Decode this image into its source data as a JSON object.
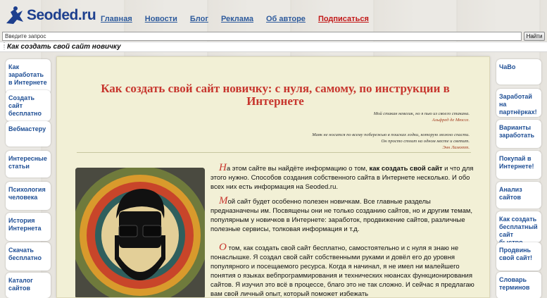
{
  "header": {
    "logo_text": "Seoded.ru",
    "nav": [
      {
        "label": "Главная"
      },
      {
        "label": "Новости"
      },
      {
        "label": "Блог"
      },
      {
        "label": "Реклама"
      },
      {
        "label": "Об авторе"
      },
      {
        "label": "Подписаться"
      }
    ]
  },
  "search": {
    "placeholder": "Введите запрос",
    "button_label": "Найти"
  },
  "breadcrumb": {
    "title": "Как создать свой сайт новичку"
  },
  "left_menu": [
    {
      "label": "Как заработать в Интернете"
    },
    {
      "label": "Создать сайт бесплатно"
    },
    {
      "label": "Вебмастеру"
    },
    {
      "label": "Интересные статьи"
    },
    {
      "label": "Психология человека"
    },
    {
      "label": "История Интернета"
    },
    {
      "label": "Скачать бесплатно"
    },
    {
      "label": "Каталог сайтов"
    }
  ],
  "right_menu": [
    {
      "label": "ЧаВо"
    },
    {
      "label": "Заработай на партнёрках!"
    },
    {
      "label": "Варианты заработать"
    },
    {
      "label": "Покупай в Интернете!"
    },
    {
      "label": "Анализ сайтов"
    },
    {
      "label": "Как создать бесплатный сайт быстро"
    },
    {
      "label": "Продвинь свой сайт!"
    },
    {
      "label": "Словарь терминов"
    }
  ],
  "article": {
    "title": "Как создать свой сайт новичку: с нуля, самому, по инструкции в Интернете",
    "epigraph1_text": "Мой стакан невелик, но я пью из своего стакана.",
    "epigraph1_author": "Альфред де Мюссе.",
    "epigraph2_line1": "Маяк не носится по всему побережью в поисках лодки, которую можно спасти.",
    "epigraph2_line2": "Он просто стоит на одном месте и светит.",
    "epigraph2_author": "Энн Ламотт.",
    "p1_cap": "Н",
    "p1_before": "а этом сайте вы найдёте информацию о том, ",
    "p1_bold": "как создать свой сайт",
    "p1_after": " и что для этого нужно. Способов создания собственного сайта в Интернете несколько. И обо всех них есть информация на Seoded.ru.",
    "p2_cap": "М",
    "p2_text": "ой сайт будет особенно полезен новичкам. Все главные разделы предназначены им. Посвящены они не только созданию сайтов, но и другим темам, популярным у новичков в Интернете: заработок, продвижение сайтов, различные полезные сервисы, толковая информация и т.д.",
    "p3_cap": "О",
    "p3_text": " том, как создать свой сайт бесплатно, самостоятельно и с нуля я знаю не понаслышке. Я создал свой сайт собственными руками и довёл его до уровня популярного и посещаемого ресурса. Когда я начинал, я не имел ни малейшего понятия о языках вебпрограммирования и технических нюансах функционирования сайтов. Я изучил это всё в процессе, благо это не так сложно. И сейчас я предлагаю вам свой личный опыт, который поможет избежать"
  },
  "colors": {
    "accent_red": "#c7362e",
    "link_blue": "#2d5a9c",
    "content_bg": "#f2f0d6"
  }
}
